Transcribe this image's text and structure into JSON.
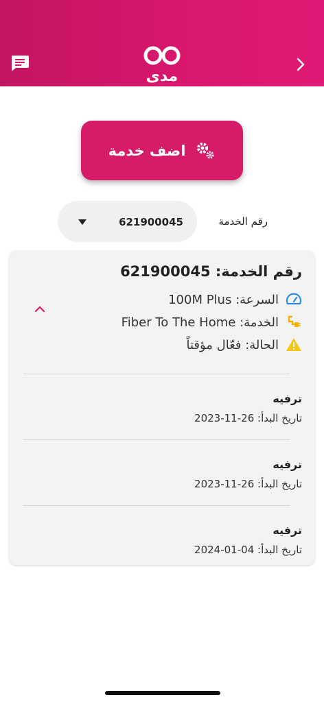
{
  "header": {
    "logo_text": "مدى",
    "colors": {
      "gradient_start": "#c21560",
      "gradient_end": "#e01a74"
    },
    "icons": {
      "left": "chat-icon",
      "right": "chevron-right-icon"
    }
  },
  "actions": {
    "add_service_label": "اضف خدمة",
    "add_service_icon": "gears-icon",
    "button_color": "#d61b69"
  },
  "service_selector": {
    "label": "رقم الخدمة",
    "selected_value": "621900045"
  },
  "service_card": {
    "title": "رقم الخدمة: 621900045",
    "speed": "السرعة: 100M Plus",
    "service_type": "الخدمة: Fiber To The Home",
    "status": "الحالة: فعّال مؤقتاً",
    "icons": {
      "speed": "speedometer-icon",
      "service": "plug-icon",
      "status": "warning-icon",
      "toggle": "chevron-up-icon"
    },
    "status_color": "#f5c518",
    "plans": [
      {
        "name": "ترفيه",
        "start_date": "تاريخ البدأ: 26-11-2023"
      },
      {
        "name": "ترفيه",
        "start_date": "تاريخ البدأ: 26-11-2023"
      },
      {
        "name": "ترفيه",
        "start_date": "تاريخ البدأ: 04-01-2024"
      }
    ]
  }
}
